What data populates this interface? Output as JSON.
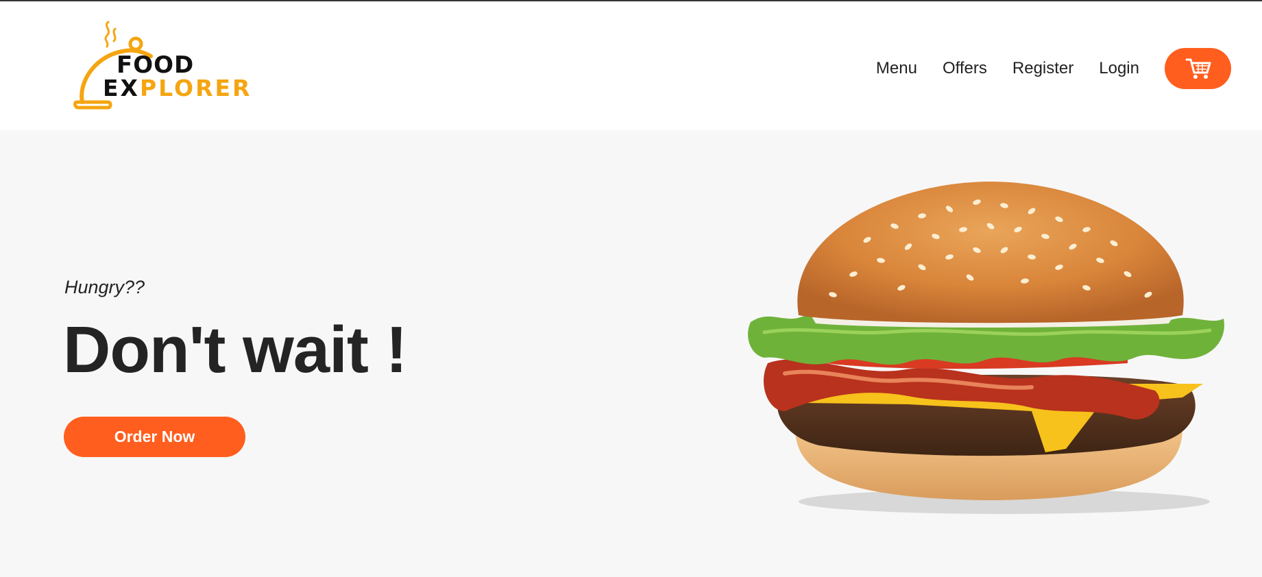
{
  "brand": {
    "line1": "FOOD",
    "line2_dark": "EX",
    "line2_orange": "PLORER",
    "colors": {
      "orange": "#f5a511",
      "dark": "#111111"
    }
  },
  "nav": {
    "items": [
      {
        "label": "Menu"
      },
      {
        "label": "Offers"
      },
      {
        "label": "Register"
      },
      {
        "label": "Login"
      }
    ],
    "cart_icon": "shopping-cart-icon"
  },
  "hero": {
    "tagline": "Hungry??",
    "headline": "Don't wait !",
    "cta_label": "Order Now",
    "image": "burger"
  },
  "colors": {
    "accent": "#ff5e1e",
    "hero_bg": "#f7f7f7",
    "header_bg": "#ffffff",
    "text": "#222222"
  }
}
